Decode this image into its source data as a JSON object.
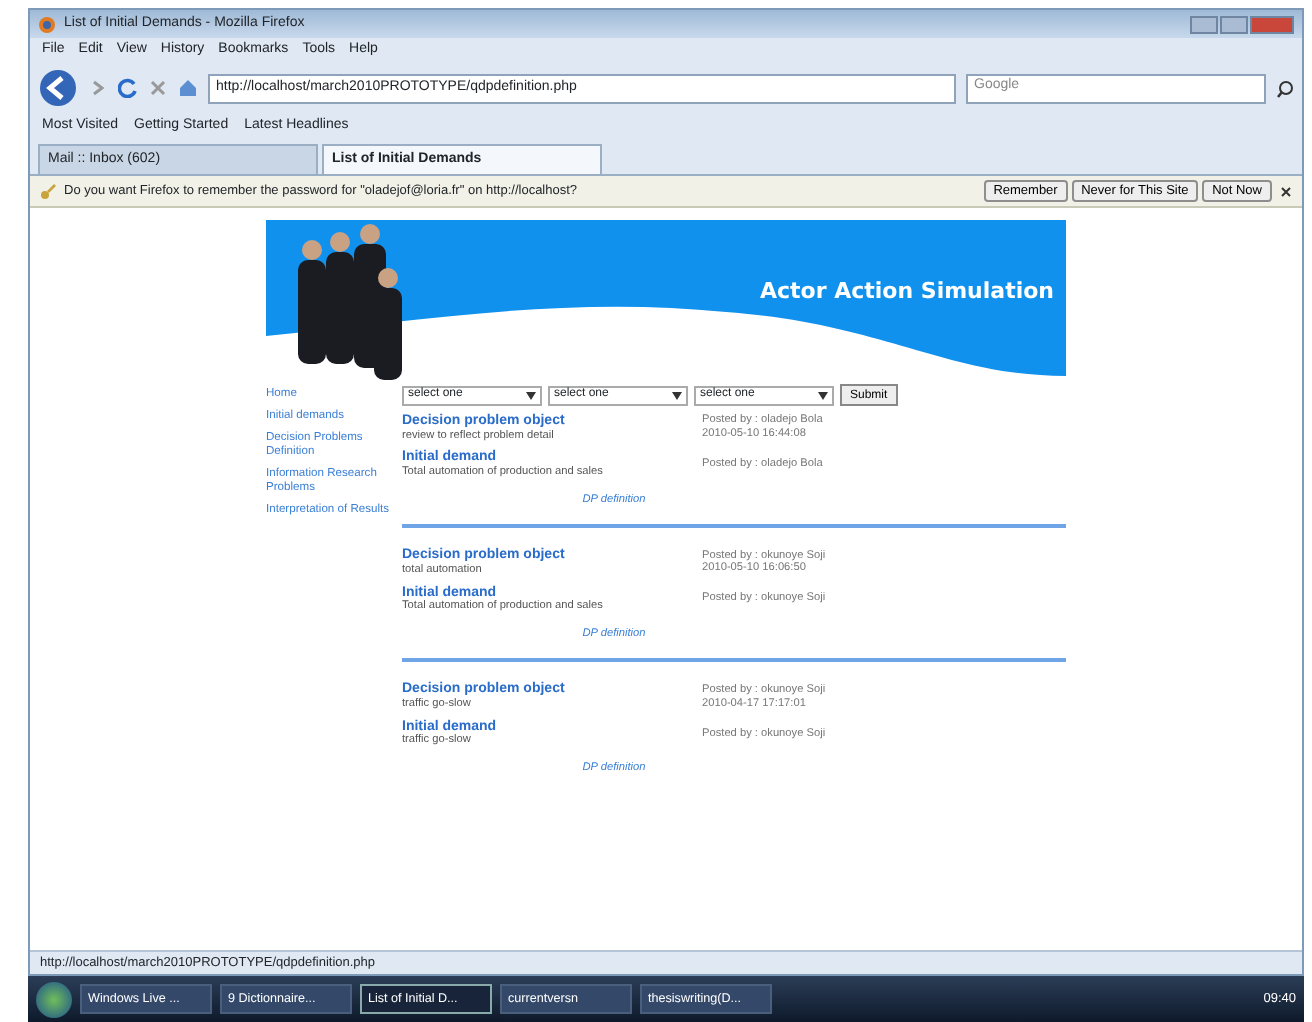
{
  "window": {
    "title": "List of Initial Demands - Mozilla Firefox"
  },
  "menu": [
    "File",
    "Edit",
    "View",
    "History",
    "Bookmarks",
    "Tools",
    "Help"
  ],
  "address_bar": {
    "value": "http://localhost/march2010PROTOTYPE/qdpdefinition.php"
  },
  "search": {
    "placeholder": "Google"
  },
  "bookmarks": [
    "Most Visited",
    "Getting Started",
    "Latest Headlines"
  ],
  "tabs": [
    {
      "label": "Mail :: Inbox (602)",
      "selected": false
    },
    {
      "label": "List of Initial Demands",
      "selected": true
    }
  ],
  "notification": {
    "message": "Do you want Firefox to remember the password for \"oladejof@loria.fr\" on http://localhost?",
    "buttons": [
      "Remember",
      "Never for This Site",
      "Not Now"
    ]
  },
  "page": {
    "banner_title": "Actor Action Simulation",
    "sidebar": [
      "Home",
      "Initial demands",
      "Decision Problems Definition",
      "Information Research Problems",
      "Interpretation of Results"
    ],
    "filters": [
      "select one",
      "select one",
      "select one"
    ],
    "submit": "Submit",
    "groups": [
      {
        "entries": [
          {
            "title": "Decision problem object",
            "text": "review to reflect problem detail",
            "posted": "Posted by : oladejo Bola",
            "date": "2010-05-10 16:44:08"
          },
          {
            "title": "Initial demand",
            "text": "Total automation of production and sales",
            "posted": "Posted by : oladejo Bola"
          }
        ],
        "link": "DP definition"
      },
      {
        "entries": [
          {
            "title": "Decision problem object",
            "text": "total automation",
            "posted": "Posted by : okunoye Soji",
            "date": "2010-05-10 16:06:50"
          },
          {
            "title": "Initial demand",
            "text": "Total automation of production and sales",
            "posted": "Posted by : okunoye Soji"
          }
        ],
        "link": "DP definition"
      },
      {
        "entries": [
          {
            "title": "Decision problem object",
            "text": "traffic go-slow",
            "posted": "Posted by : okunoye Soji",
            "date": "2010-04-17 17:17:01"
          },
          {
            "title": "Initial demand",
            "text": "traffic go-slow",
            "posted": "Posted by : okunoye Soji"
          }
        ],
        "link": "DP definition"
      }
    ]
  },
  "status_bar": "http://localhost/march2010PROTOTYPE/qdpdefinition.php",
  "taskbar": [
    {
      "label": "Windows Live ...",
      "selected": false
    },
    {
      "label": "9 Dictionnaire...",
      "selected": false
    },
    {
      "label": "List of Initial D...",
      "selected": true
    },
    {
      "label": "currentversn",
      "selected": false
    },
    {
      "label": "thesiswriting(D...",
      "selected": false
    }
  ],
  "clock": "09:40"
}
